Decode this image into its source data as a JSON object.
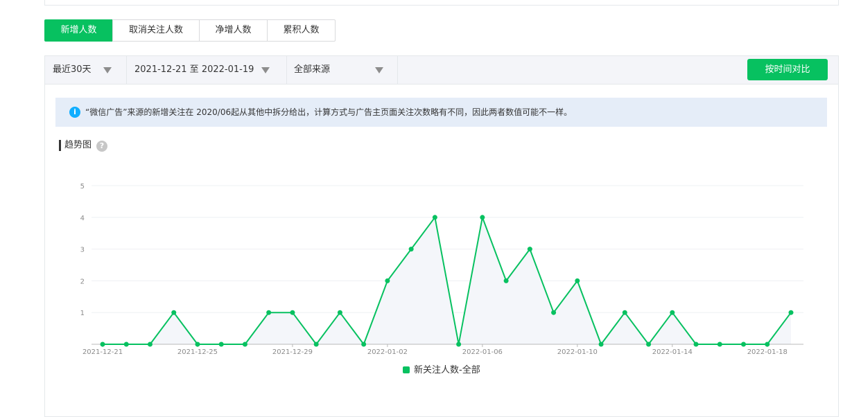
{
  "tabs": [
    {
      "label": "新增人数",
      "active": true
    },
    {
      "label": "取消关注人数",
      "active": false
    },
    {
      "label": "净增人数",
      "active": false
    },
    {
      "label": "累积人数",
      "active": false
    }
  ],
  "filters": {
    "range_label": "最近30天",
    "date_range": "2021-12-21 至 2022-01-19",
    "source_label": "全部来源"
  },
  "compare_button": "按时间对比",
  "notice": {
    "icon": "info-icon",
    "text": "“微信广告”来源的新增关注在 2020/06起从其他中拆分给出，计算方式与广告主页面关注次数略有不同，因此两者数值可能不一样。"
  },
  "trend": {
    "title": "趋势图",
    "help_icon": "?"
  },
  "colors": {
    "accent": "#07c160",
    "notice_bg": "#e5edf8",
    "info_icon": "#10aeff"
  },
  "chart_data": {
    "type": "line",
    "x": [
      "2021-12-21",
      "2021-12-22",
      "2021-12-23",
      "2021-12-24",
      "2021-12-25",
      "2021-12-26",
      "2021-12-27",
      "2021-12-28",
      "2021-12-29",
      "2021-12-30",
      "2021-12-31",
      "2022-01-01",
      "2022-01-02",
      "2022-01-03",
      "2022-01-04",
      "2022-01-05",
      "2022-01-06",
      "2022-01-07",
      "2022-01-08",
      "2022-01-09",
      "2022-01-10",
      "2022-01-11",
      "2022-01-12",
      "2022-01-13",
      "2022-01-14",
      "2022-01-15",
      "2022-01-16",
      "2022-01-17",
      "2022-01-18",
      "2022-01-19"
    ],
    "x_tick_labels": [
      "2021-12-21",
      "2021-12-25",
      "2021-12-29",
      "2022-01-02",
      "2022-01-06",
      "2022-01-10",
      "2022-01-14",
      "2022-01-18"
    ],
    "series": [
      {
        "name": "新关注人数-全部",
        "values": [
          0,
          0,
          0,
          1,
          0,
          0,
          0,
          1,
          1,
          0,
          1,
          0,
          2,
          3,
          4,
          0,
          4,
          2,
          3,
          1,
          2,
          0,
          1,
          0,
          1,
          0,
          0,
          0,
          0,
          1
        ]
      }
    ],
    "y_ticks": [
      "1",
      "2",
      "3",
      "4",
      "5"
    ],
    "ylim": [
      0,
      5
    ],
    "grid": true,
    "legend_position": "bottom-center",
    "area_fill": "#f4f6fa"
  }
}
